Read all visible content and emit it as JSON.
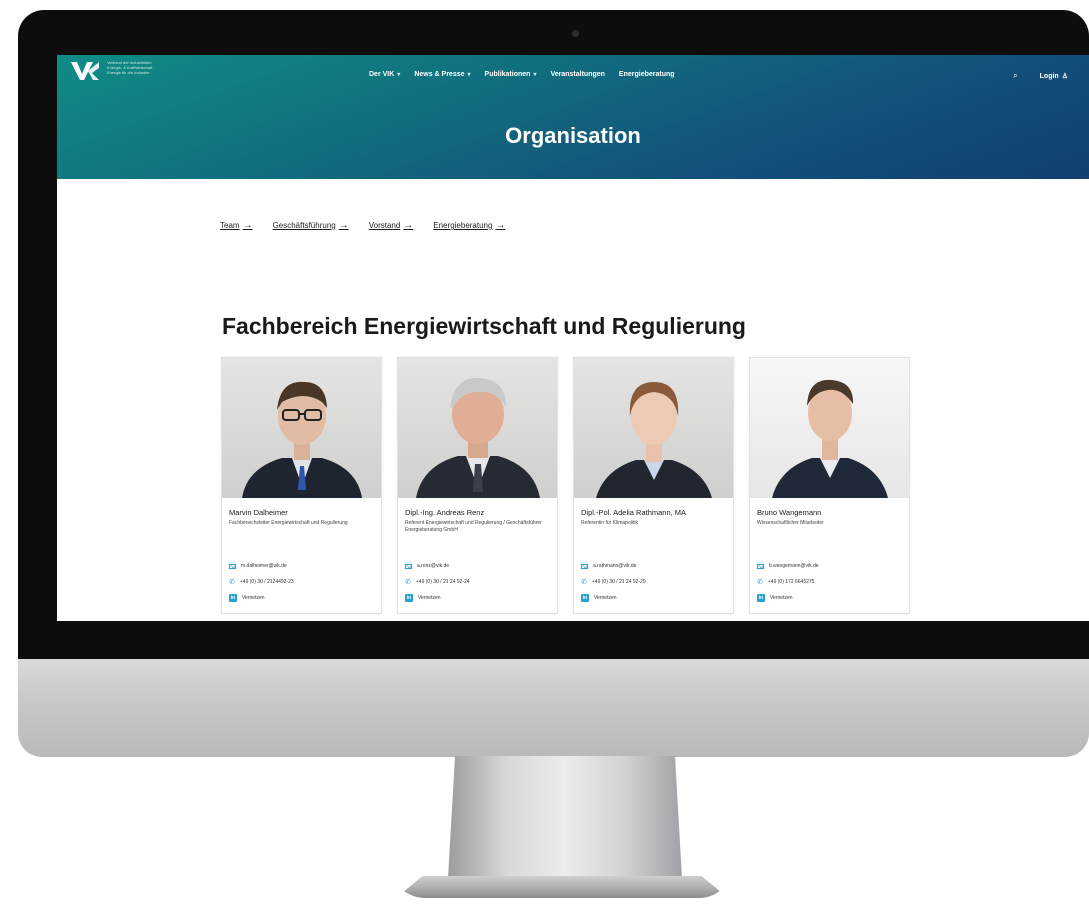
{
  "logo": {
    "lines": [
      "Verband der Industriellen",
      "Energie- & Kraftwirtschaft",
      "Energie für die Industrie"
    ]
  },
  "nav": {
    "items": [
      {
        "label": "Der VIK",
        "has_dropdown": true
      },
      {
        "label": "News & Presse",
        "has_dropdown": true
      },
      {
        "label": "Publikationen",
        "has_dropdown": true
      },
      {
        "label": "Veranstaltungen",
        "has_dropdown": false
      },
      {
        "label": "Energieberatung",
        "has_dropdown": false
      }
    ],
    "login": "Login"
  },
  "page": {
    "title": "Organisation",
    "section_title": "Fachbereich Energiewirtschaft und Regulierung"
  },
  "subnav": [
    {
      "label": "Team"
    },
    {
      "label": "Geschäftsführung"
    },
    {
      "label": "Vorstand"
    },
    {
      "label": "Energieberatung"
    }
  ],
  "team": [
    {
      "name": "Marvin Dalheimer",
      "role": "Fachbereichsleiter Energiewirtschaft und Regulierung",
      "email": "m.dalheimer@vik.de",
      "phone": "+49 (0) 30 / 2124492-23",
      "network_label": "Vernetzen"
    },
    {
      "name": "Dipl.-Ing. Andreas Renz",
      "role": "Referent Energiewirtschaft und Regulierung / Geschäftsführer Energieberatung GmbH",
      "email": "a.renz@vik.de",
      "phone": "+49 (0) 30 / 21 24 92-24",
      "network_label": "Vernetzen"
    },
    {
      "name": "Dipl.-Pol. Adelia Rathmann, MA",
      "role": "Referentin für Klimapolitik",
      "email": "a.rathmann@vik.de",
      "phone": "+49 (0) 30 / 21 24 92-29",
      "network_label": "Vernetzen"
    },
    {
      "name": "Bruno Wangemann",
      "role": "Wissenschaftlicher Mitarbeiter",
      "email": "b.wangemann@vik.de",
      "phone": "+49 (0) 172 6645275",
      "network_label": "Vernetzen"
    }
  ],
  "colors": {
    "hero_start": "#0f8d86",
    "hero_end": "#123f6e",
    "icon_accent": "#2b9fd2"
  }
}
